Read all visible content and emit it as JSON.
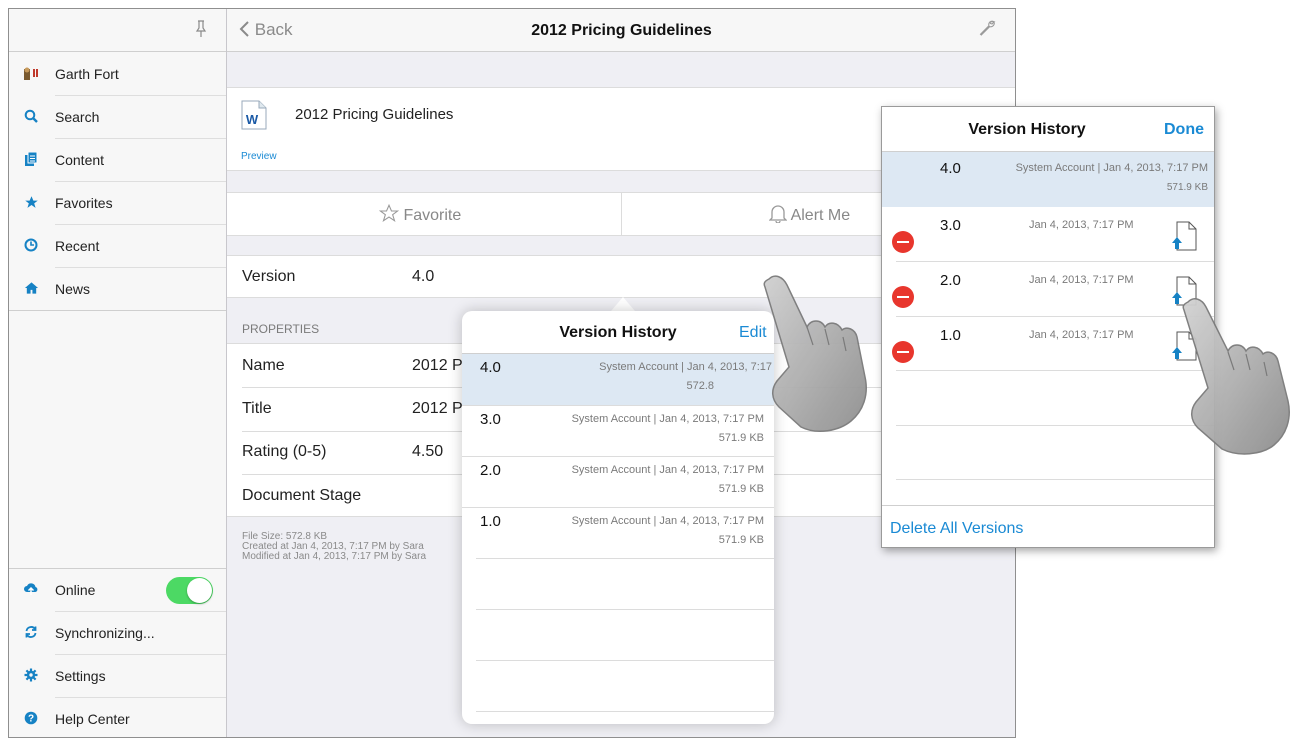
{
  "sidebar": {
    "items": [
      {
        "label": "Garth Fort",
        "icon": "user-avatar-icon"
      },
      {
        "label": "Search",
        "icon": "search-icon"
      },
      {
        "label": "Content",
        "icon": "content-icon"
      },
      {
        "label": "Favorites",
        "icon": "star-icon"
      },
      {
        "label": "Recent",
        "icon": "clock-icon"
      },
      {
        "label": "News",
        "icon": "home-icon"
      }
    ],
    "bottom_items": [
      {
        "label": "Online",
        "icon": "cloud-upload-icon"
      },
      {
        "label": "Synchronizing...",
        "icon": "sync-icon"
      },
      {
        "label": "Settings",
        "icon": "gear-icon"
      },
      {
        "label": "Help Center",
        "icon": "help-icon"
      }
    ],
    "online_toggle": "on"
  },
  "navbar": {
    "back_label": "Back",
    "title": "2012 Pricing Guidelines"
  },
  "document": {
    "name": "2012 Pricing Guidelines",
    "preview_label": "Preview",
    "icon": "word-document-icon"
  },
  "actions": {
    "favorite_label": "Favorite",
    "alert_label": "Alert Me"
  },
  "version_row": {
    "label": "Version",
    "value": "4.0"
  },
  "properties": {
    "header": "PROPERTIES",
    "rows": [
      {
        "label": "Name",
        "value": "2012 P"
      },
      {
        "label": "Title",
        "value": "2012 P"
      },
      {
        "label": "Rating (0-5)",
        "value": "4.50"
      },
      {
        "label": "Document Stage",
        "value": ""
      }
    ],
    "footer": [
      "File Size: 572.8 KB",
      "Created at Jan 4, 2013, 7:17 PM by Sara",
      "Modified at Jan 4, 2013, 7:17 PM by Sara"
    ]
  },
  "version_popover": {
    "title": "Version History",
    "edit_label": "Edit",
    "rows": [
      {
        "num": "4.0",
        "meta": "System Account | Jan 4, 2013, 7:17",
        "size": "572.8"
      },
      {
        "num": "3.0",
        "meta": "System Account | Jan 4, 2013, 7:17 PM",
        "size": "571.9 KB"
      },
      {
        "num": "2.0",
        "meta": "System Account | Jan 4, 2013, 7:17 PM",
        "size": "571.9 KB"
      },
      {
        "num": "1.0",
        "meta": "System Account | Jan 4, 2013, 7:17 PM",
        "size": "571.9 KB"
      }
    ]
  },
  "version_panel": {
    "title": "Version History",
    "done_label": "Done",
    "current": {
      "num": "4.0",
      "meta": "System Account | Jan 4, 2013, 7:17 PM",
      "size": "571.9 KB"
    },
    "rows": [
      {
        "num": "3.0",
        "date": "Jan 4, 2013, 7:17 PM"
      },
      {
        "num": "2.0",
        "date": "Jan 4, 2013, 7:17 PM"
      },
      {
        "num": "1.0",
        "date": "Jan 4, 2013, 7:17 PM"
      }
    ],
    "delete_all_label": "Delete All Versions"
  },
  "colors": {
    "accent": "#1a8ad4",
    "toggle_on": "#4cd964",
    "delete": "#e8362d"
  }
}
